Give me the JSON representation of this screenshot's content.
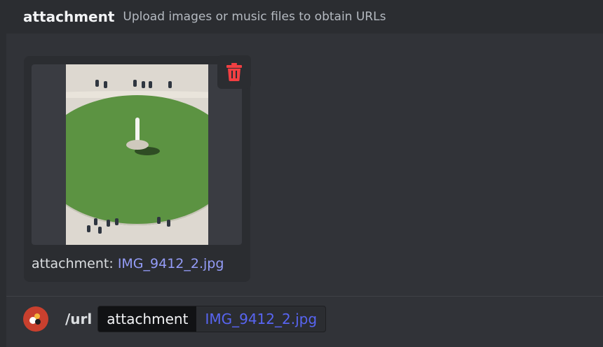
{
  "header": {
    "option_name": "attachment",
    "option_description": "Upload images or music files to obtain URLs"
  },
  "upload": {
    "caption_prefix": "attachment:",
    "filename": "IMG_9412_2.jpg",
    "delete_icon": "trash-icon",
    "delete_icon_color": "#f23f42"
  },
  "command": {
    "name": "/url",
    "option_label": "attachment",
    "option_value": "IMG_9412_2.jpg"
  },
  "colors": {
    "background": "#313338",
    "header_bg": "#2b2d31",
    "link": "#949cf7",
    "accent": "#5865f2"
  }
}
